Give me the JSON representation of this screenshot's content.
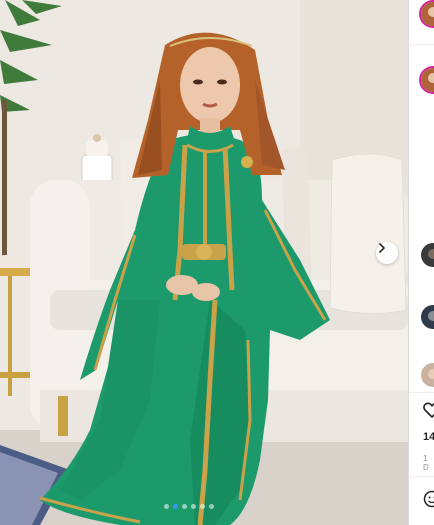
{
  "post": {
    "carousel": {
      "total_slides": 6,
      "active_slide": 2
    },
    "next_icon": "chevron-right-icon"
  },
  "sidebar": {
    "likes_count": "14",
    "date": "1 D"
  },
  "colors": {
    "dress": "#1c9a6c",
    "gold_trim": "#c9a24a",
    "sofa": "#f1ede6",
    "accent": "#3897f0"
  }
}
